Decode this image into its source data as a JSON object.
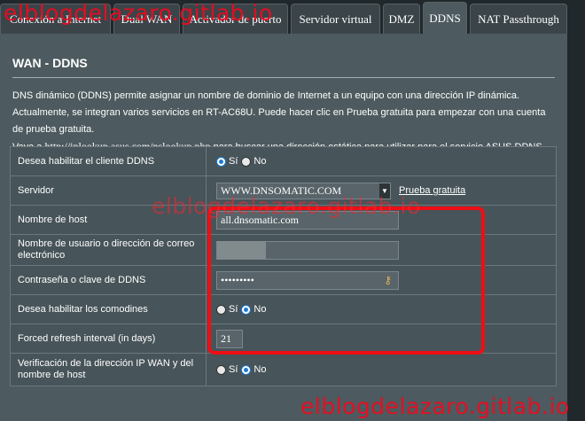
{
  "tabs": [
    {
      "label": "Conexión a Internet",
      "active": false
    },
    {
      "label": "Dual WAN",
      "active": false
    },
    {
      "label": "Activador de puerto",
      "active": false
    },
    {
      "label": "Servidor virtual",
      "active": false
    },
    {
      "label": "DMZ",
      "active": false
    },
    {
      "label": "DDNS",
      "active": true
    },
    {
      "label": "NAT Passthrough",
      "active": false
    }
  ],
  "page_title": "WAN - DDNS",
  "description": {
    "line1": "DNS dinámico (DDNS) permite asignar un nombre de dominio de Internet a un equipo con una dirección IP dinámica. Actualmente, se integran varios servicios en RT-AC68U. Puede hacer clic en Prueba gratuita para empezar con una cuenta de prueba gratuita.",
    "line2_prefix": "Vaya a ",
    "line2_link": "http://iplookup.asus.com/nslookup.php",
    "line2_suffix": " para buscar una dirección estática para utilizar para el servicio ASUS DDNS."
  },
  "form": {
    "enable_ddns": {
      "label": "Desea habilitar el cliente DDNS",
      "yes": "Sí",
      "no": "No",
      "selected": "yes"
    },
    "server": {
      "label": "Servidor",
      "value": "WWW.DNSOMATIC.COM",
      "link": "Prueba gratuita"
    },
    "host": {
      "label": "Nombre de host",
      "value": "all.dnsomatic.com"
    },
    "username": {
      "label": "Nombre de usuario o dirección de correo electrónico",
      "value": ""
    },
    "password": {
      "label": "Contraseña o clave de DDNS",
      "value": "•••••••••"
    },
    "wildcard": {
      "label": "Desea habilitar los comodines",
      "yes": "Sí",
      "no": "No",
      "selected": "no"
    },
    "refresh": {
      "label": "Forced refresh interval (in days)",
      "value": "21"
    },
    "verify": {
      "label": "Verificación de la dirección IP WAN y del nombre de host",
      "yes": "Sí",
      "no": "No",
      "selected": "no"
    }
  },
  "watermark": "elblogdelazaro.gitlab.io",
  "colors": {
    "highlight": "#ef0e15",
    "radio_selected": "#1e7bd6",
    "panel": "#4d5a5f"
  }
}
